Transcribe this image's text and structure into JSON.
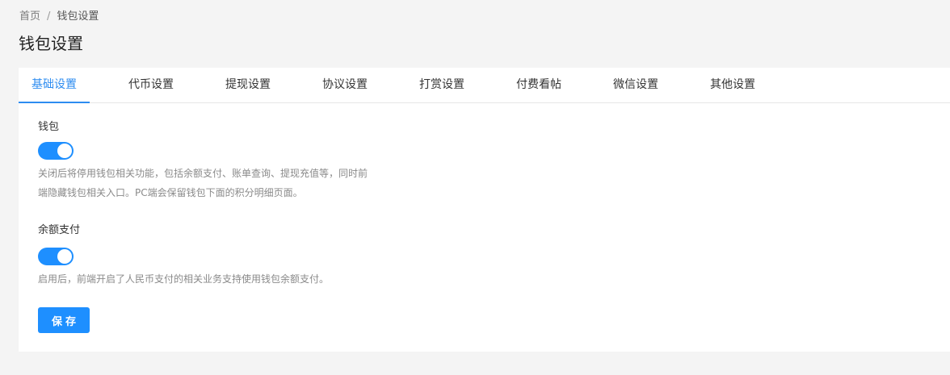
{
  "breadcrumb": {
    "home": "首页",
    "separator": "/",
    "current": "钱包设置"
  },
  "page": {
    "title": "钱包设置"
  },
  "tabs": [
    {
      "label": "基础设置",
      "active": true
    },
    {
      "label": "代币设置",
      "active": false
    },
    {
      "label": "提现设置",
      "active": false
    },
    {
      "label": "协议设置",
      "active": false
    },
    {
      "label": "打赏设置",
      "active": false
    },
    {
      "label": "付费看帖",
      "active": false
    },
    {
      "label": "微信设置",
      "active": false
    },
    {
      "label": "其他设置",
      "active": false
    }
  ],
  "settings": {
    "wallet": {
      "label": "钱包",
      "enabled": true,
      "help_line1": "关闭后将停用钱包相关功能，包括余额支付、账单查询、提现充值等，同时前",
      "help_line2": "端隐藏钱包相关入口。PC端会保留钱包下面的积分明细页面。"
    },
    "balance_pay": {
      "label": "余额支付",
      "enabled": true,
      "help": "启用后，前端开启了人民币支付的相关业务支持使用钱包余额支付。"
    }
  },
  "actions": {
    "save_label": "保存"
  },
  "colors": {
    "accent": "#1e8fff",
    "active_tab": "#2d8cf0"
  }
}
